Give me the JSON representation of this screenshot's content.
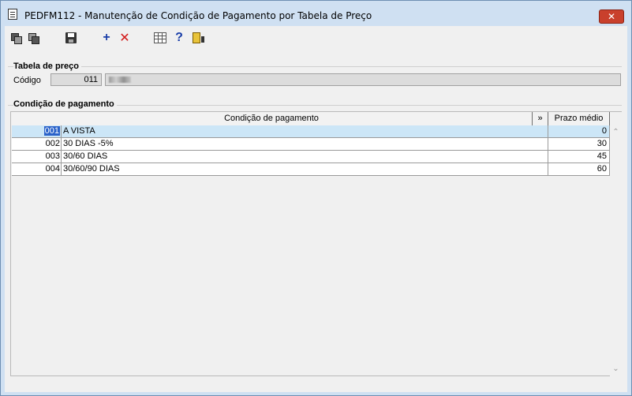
{
  "window": {
    "title": "PEDFM112 - Manutenção de Condição de Pagamento por Tabela de Preço",
    "close_label": "✕"
  },
  "toolbar": {
    "first_icon": "first-record-icon",
    "last_icon": "last-record-icon",
    "save_icon": "save-icon",
    "add_label": "+",
    "delete_label": "✕",
    "grid_icon": "grid-icon",
    "help_label": "?",
    "exit_icon": "exit-icon"
  },
  "tabela": {
    "group_title": "Tabela de preço",
    "codigo_label": "Código",
    "codigo_value": "011"
  },
  "condicao": {
    "group_title": "Condição de pagamento",
    "columns": {
      "descricao": "Condição de pagamento",
      "expand": "»",
      "prazo": "Prazo médio"
    },
    "rows": [
      {
        "code": "001",
        "descricao": "A VISTA",
        "prazo": "0"
      },
      {
        "code": "002",
        "descricao": "30 DIAS -5%",
        "prazo": "30"
      },
      {
        "code": "003",
        "descricao": "30/60 DIAS",
        "prazo": "45"
      },
      {
        "code": "004",
        "descricao": "30/60/90 DIAS",
        "prazo": "60"
      }
    ],
    "scroll_up": "⌃",
    "scroll_down": "⌄"
  }
}
